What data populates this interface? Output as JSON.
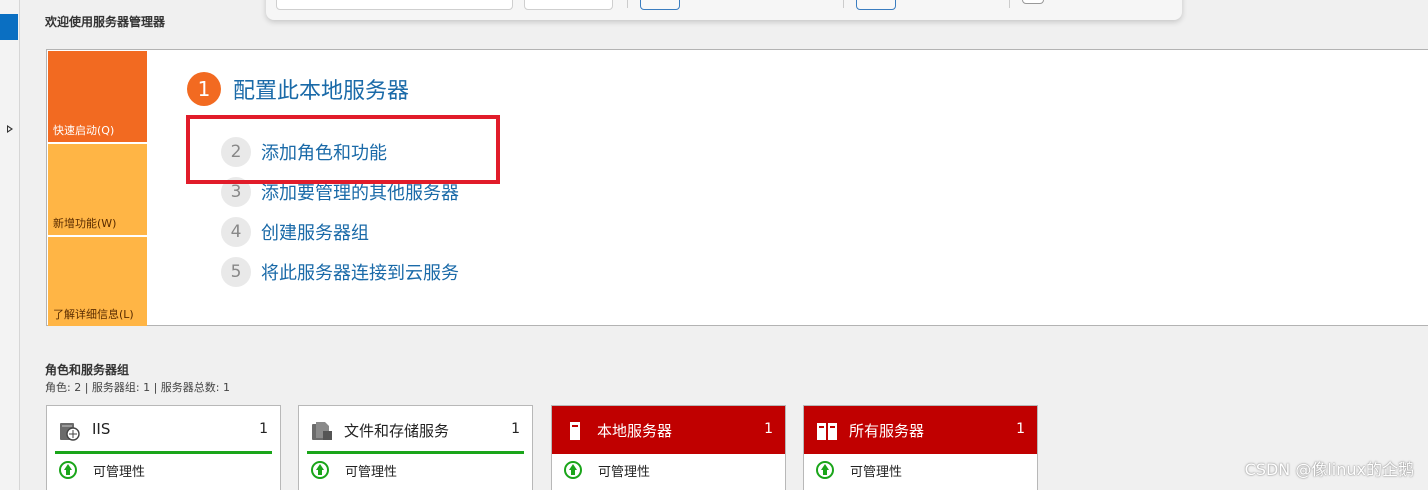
{
  "welcome": {
    "title": "欢迎使用服务器管理器",
    "quick_start": [
      "快速启动(Q)",
      "新增功能(W)",
      "了解详细信息(L)"
    ],
    "steps": [
      {
        "num": "1",
        "label": "配置此本地服务器"
      },
      {
        "num": "2",
        "label": "添加角色和功能"
      },
      {
        "num": "3",
        "label": "添加要管理的其他服务器"
      },
      {
        "num": "4",
        "label": "创建服务器组"
      },
      {
        "num": "5",
        "label": "将此服务器连接到云服务"
      }
    ]
  },
  "roles": {
    "title": "角色和服务器组",
    "summary": "角色: 2 | 服务器组: 1 | 服务器总数: 1",
    "tiles": [
      {
        "name": "IIS",
        "count": "1",
        "status": "可管理性",
        "icon": "iis-icon"
      },
      {
        "name": "文件和存储服务",
        "count": "1",
        "status": "可管理性",
        "icon": "file-storage-icon"
      },
      {
        "name": "本地服务器",
        "count": "1",
        "status": "可管理性",
        "icon": "server-icon",
        "header_color": "#c00000"
      },
      {
        "name": "所有服务器",
        "count": "1",
        "status": "可管理性",
        "icon": "servers-icon",
        "header_color": "#c00000"
      }
    ]
  },
  "colors": {
    "accent_orange": "#f26a21",
    "tile_yellow": "#ffb545",
    "link_blue": "#1a6aa8",
    "highlight_red": "#e11c2a",
    "status_green": "#1aa51a"
  },
  "watermark": "CSDN @像linux的企鹅"
}
